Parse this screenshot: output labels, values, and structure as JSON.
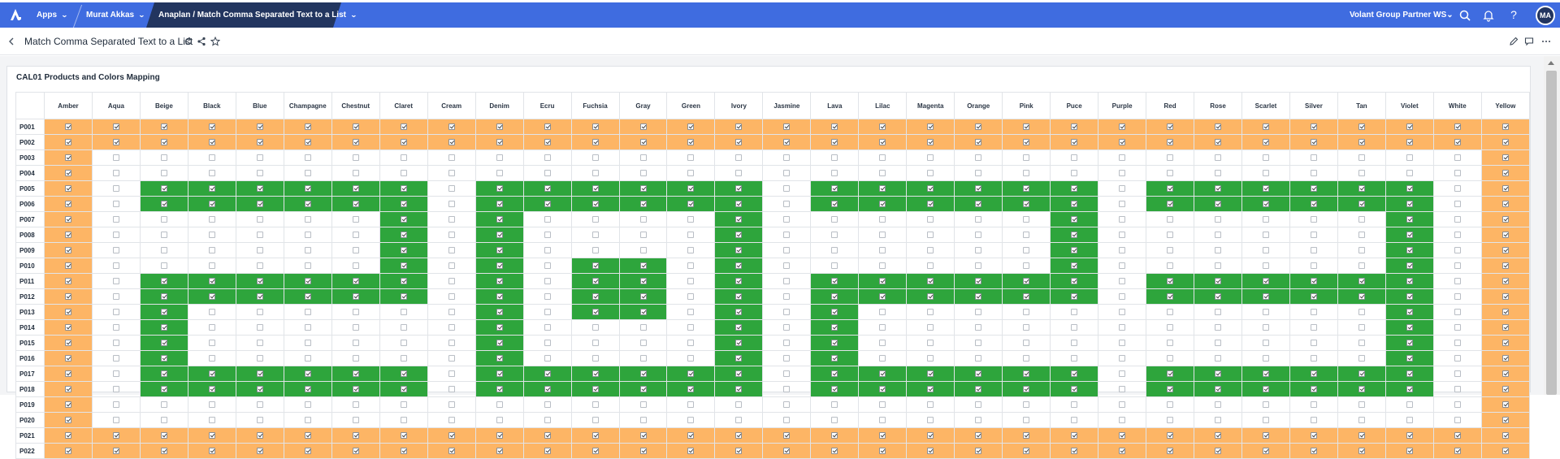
{
  "topbar": {
    "apps_label": "Apps",
    "user_label": "Murat Akkas",
    "model_label": "Anaplan / Match Comma Separated Text to a List",
    "workspace_label": "Volant Group Partner WS",
    "avatar_initials": "MA",
    "help_label": "?",
    "bar_color": "#3f6ce0",
    "active_color": "#22355f",
    "icons": [
      "anaplan-logo-icon",
      "search-icon",
      "bell-icon",
      "help-icon"
    ]
  },
  "titlebar": {
    "title": "Match Comma Separated Text to a List",
    "icons": [
      "back-icon",
      "refresh-icon",
      "share-icon",
      "star-icon",
      "edit-icon",
      "comment-icon",
      "more-icon"
    ]
  },
  "grid": {
    "title": "CAL01 Products and Colors Mapping",
    "orange_color": "#fdb565",
    "green_color": "#2ea53c",
    "columns": [
      "Amber",
      "Aqua",
      "Beige",
      "Black",
      "Blue",
      "Champagne",
      "Chestnut",
      "Claret",
      "Cream",
      "Denim",
      "Ecru",
      "Fuchsia",
      "Gray",
      "Green",
      "Ivory",
      "Jasmine",
      "Lava",
      "Lilac",
      "Magenta",
      "Orange",
      "Pink",
      "Puce",
      "Purple",
      "Red",
      "Rose",
      "Scarlet",
      "Silver",
      "Tan",
      "Violet",
      "White",
      "Yellow"
    ],
    "rows": [
      {
        "label": "P001",
        "cells": "OOOOOOOOOOOOOOOOOOOOOOOOOOOOOOO"
      },
      {
        "label": "P002",
        "cells": "OOOOOOOOOOOOOOOOOOOOOOOOOOOOOOO"
      },
      {
        "label": "P003",
        "cells": "O.............................O"
      },
      {
        "label": "P004",
        "cells": "O.............................O"
      },
      {
        "label": "P005",
        "cells": "O.GGGGGG.GGGGGG.GGGGGG.GGGGGG.O"
      },
      {
        "label": "P006",
        "cells": "O.GGGGGG.GGGGGG.GGGGGG.GGGGGG.O"
      },
      {
        "label": "P007",
        "cells": "O......G.G....G......G......G.O"
      },
      {
        "label": "P008",
        "cells": "O......G.G....G......G......G.O"
      },
      {
        "label": "P009",
        "cells": "O......G.G....G......G......G.O"
      },
      {
        "label": "P010",
        "cells": "O......G.G.GG.G......G......G.O"
      },
      {
        "label": "P011",
        "cells": "O.GGGGGG.G.GG.G.GGGGGG.GGGGGG.O"
      },
      {
        "label": "P012",
        "cells": "O.GGGGGG.G.GG.G.GGGGGG.GGGGGG.O"
      },
      {
        "label": "P013",
        "cells": "O.G......G.GG.G.G...........G.O"
      },
      {
        "label": "P014",
        "cells": "O.G......G....G.G...........G.O"
      },
      {
        "label": "P015",
        "cells": "O.G......G....G.G...........G.O"
      },
      {
        "label": "P016",
        "cells": "O.G......G....G.G...........G.O"
      },
      {
        "label": "P017",
        "cells": "O.GGGGGG.GGGGGG.GGGGGG.GGGGGG.O"
      },
      {
        "label": "P018",
        "cells": "O.GGGGGG.GGGGGG.GGGGGG.GGGGGG.O"
      },
      {
        "label": "P019",
        "cells": "O.............................O"
      },
      {
        "label": "P020",
        "cells": "O.............................O"
      },
      {
        "label": "P021",
        "cells": "OOOOOOOOOOOOOOOOOOOOOOOOOOOOOOO"
      },
      {
        "label": "P022",
        "cells": "OOOOOOOOOOOOOOOOOOOOOOOOOOOOOOO"
      }
    ]
  }
}
